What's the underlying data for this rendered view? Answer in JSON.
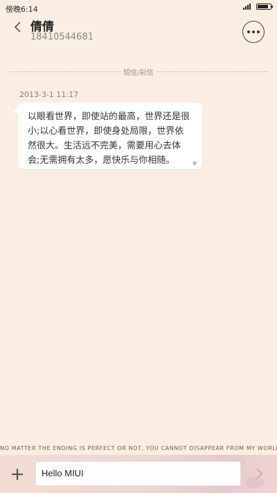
{
  "status_bar": {
    "time": "傍晚6:14",
    "signal_icon": "signal-icon",
    "battery_icon": "battery-icon"
  },
  "header": {
    "back_icon": "chevron-left-icon",
    "contact_name": "倩倩",
    "contact_number": "18410544681",
    "more_icon": "more-dots-icon"
  },
  "thread": {
    "divider_label": "短信/彩信",
    "messages": [
      {
        "timestamp": "2013-3-1 11:17",
        "text": "以眼看世界，即使站的最高，世界还是很小;以心看世界，即使身处局限，世界依然很大。生活远不完美，需要用心去体会;无需拥有太多，愿快乐与你相随。",
        "star_icon": "star-icon"
      }
    ]
  },
  "banner_text": "NO MATTER THE ENDING IS PERFECT OR NOT, YOU CANNOT DISAPPEAR FROM MY WORLD.",
  "composer": {
    "add_icon": "plus-icon",
    "input_value": "Hello MIUI",
    "send_icon": "chevron-right-icon"
  },
  "colors": {
    "background": "#faeee2",
    "bubble": "#ffffff",
    "text": "#333333",
    "muted": "#8a7f72"
  }
}
